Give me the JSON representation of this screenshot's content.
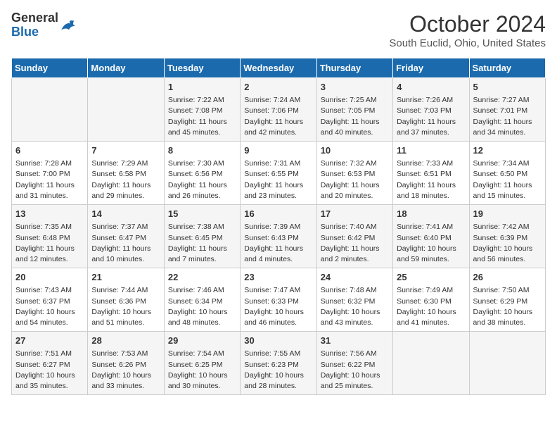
{
  "header": {
    "logo_general": "General",
    "logo_blue": "Blue",
    "month": "October 2024",
    "location": "South Euclid, Ohio, United States"
  },
  "days_of_week": [
    "Sunday",
    "Monday",
    "Tuesday",
    "Wednesday",
    "Thursday",
    "Friday",
    "Saturday"
  ],
  "weeks": [
    [
      {
        "day": "",
        "content": ""
      },
      {
        "day": "",
        "content": ""
      },
      {
        "day": "1",
        "content": "Sunrise: 7:22 AM\nSunset: 7:08 PM\nDaylight: 11 hours and 45 minutes."
      },
      {
        "day": "2",
        "content": "Sunrise: 7:24 AM\nSunset: 7:06 PM\nDaylight: 11 hours and 42 minutes."
      },
      {
        "day": "3",
        "content": "Sunrise: 7:25 AM\nSunset: 7:05 PM\nDaylight: 11 hours and 40 minutes."
      },
      {
        "day": "4",
        "content": "Sunrise: 7:26 AM\nSunset: 7:03 PM\nDaylight: 11 hours and 37 minutes."
      },
      {
        "day": "5",
        "content": "Sunrise: 7:27 AM\nSunset: 7:01 PM\nDaylight: 11 hours and 34 minutes."
      }
    ],
    [
      {
        "day": "6",
        "content": "Sunrise: 7:28 AM\nSunset: 7:00 PM\nDaylight: 11 hours and 31 minutes."
      },
      {
        "day": "7",
        "content": "Sunrise: 7:29 AM\nSunset: 6:58 PM\nDaylight: 11 hours and 29 minutes."
      },
      {
        "day": "8",
        "content": "Sunrise: 7:30 AM\nSunset: 6:56 PM\nDaylight: 11 hours and 26 minutes."
      },
      {
        "day": "9",
        "content": "Sunrise: 7:31 AM\nSunset: 6:55 PM\nDaylight: 11 hours and 23 minutes."
      },
      {
        "day": "10",
        "content": "Sunrise: 7:32 AM\nSunset: 6:53 PM\nDaylight: 11 hours and 20 minutes."
      },
      {
        "day": "11",
        "content": "Sunrise: 7:33 AM\nSunset: 6:51 PM\nDaylight: 11 hours and 18 minutes."
      },
      {
        "day": "12",
        "content": "Sunrise: 7:34 AM\nSunset: 6:50 PM\nDaylight: 11 hours and 15 minutes."
      }
    ],
    [
      {
        "day": "13",
        "content": "Sunrise: 7:35 AM\nSunset: 6:48 PM\nDaylight: 11 hours and 12 minutes."
      },
      {
        "day": "14",
        "content": "Sunrise: 7:37 AM\nSunset: 6:47 PM\nDaylight: 11 hours and 10 minutes."
      },
      {
        "day": "15",
        "content": "Sunrise: 7:38 AM\nSunset: 6:45 PM\nDaylight: 11 hours and 7 minutes."
      },
      {
        "day": "16",
        "content": "Sunrise: 7:39 AM\nSunset: 6:43 PM\nDaylight: 11 hours and 4 minutes."
      },
      {
        "day": "17",
        "content": "Sunrise: 7:40 AM\nSunset: 6:42 PM\nDaylight: 11 hours and 2 minutes."
      },
      {
        "day": "18",
        "content": "Sunrise: 7:41 AM\nSunset: 6:40 PM\nDaylight: 10 hours and 59 minutes."
      },
      {
        "day": "19",
        "content": "Sunrise: 7:42 AM\nSunset: 6:39 PM\nDaylight: 10 hours and 56 minutes."
      }
    ],
    [
      {
        "day": "20",
        "content": "Sunrise: 7:43 AM\nSunset: 6:37 PM\nDaylight: 10 hours and 54 minutes."
      },
      {
        "day": "21",
        "content": "Sunrise: 7:44 AM\nSunset: 6:36 PM\nDaylight: 10 hours and 51 minutes."
      },
      {
        "day": "22",
        "content": "Sunrise: 7:46 AM\nSunset: 6:34 PM\nDaylight: 10 hours and 48 minutes."
      },
      {
        "day": "23",
        "content": "Sunrise: 7:47 AM\nSunset: 6:33 PM\nDaylight: 10 hours and 46 minutes."
      },
      {
        "day": "24",
        "content": "Sunrise: 7:48 AM\nSunset: 6:32 PM\nDaylight: 10 hours and 43 minutes."
      },
      {
        "day": "25",
        "content": "Sunrise: 7:49 AM\nSunset: 6:30 PM\nDaylight: 10 hours and 41 minutes."
      },
      {
        "day": "26",
        "content": "Sunrise: 7:50 AM\nSunset: 6:29 PM\nDaylight: 10 hours and 38 minutes."
      }
    ],
    [
      {
        "day": "27",
        "content": "Sunrise: 7:51 AM\nSunset: 6:27 PM\nDaylight: 10 hours and 35 minutes."
      },
      {
        "day": "28",
        "content": "Sunrise: 7:53 AM\nSunset: 6:26 PM\nDaylight: 10 hours and 33 minutes."
      },
      {
        "day": "29",
        "content": "Sunrise: 7:54 AM\nSunset: 6:25 PM\nDaylight: 10 hours and 30 minutes."
      },
      {
        "day": "30",
        "content": "Sunrise: 7:55 AM\nSunset: 6:23 PM\nDaylight: 10 hours and 28 minutes."
      },
      {
        "day": "31",
        "content": "Sunrise: 7:56 AM\nSunset: 6:22 PM\nDaylight: 10 hours and 25 minutes."
      },
      {
        "day": "",
        "content": ""
      },
      {
        "day": "",
        "content": ""
      }
    ]
  ]
}
